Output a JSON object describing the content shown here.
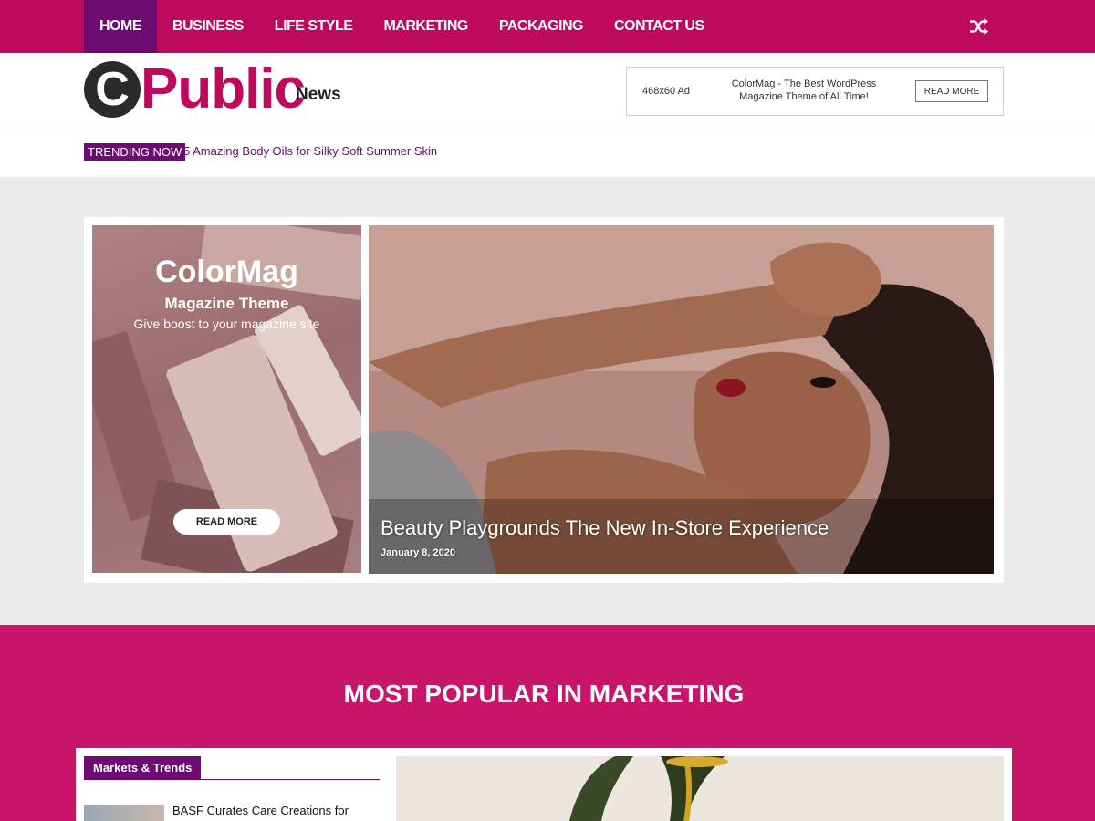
{
  "nav": {
    "items": [
      {
        "label": "HOME",
        "active": true
      },
      {
        "label": "BUSINESS"
      },
      {
        "label": "LIFE STYLE"
      },
      {
        "label": "MARKETING"
      },
      {
        "label": "PACKAGING"
      },
      {
        "label": "CONTACT US"
      }
    ],
    "random_icon": "shuffle-icon"
  },
  "logo": {
    "letter": "C",
    "main": "Public",
    "sub": "News"
  },
  "ad": {
    "size_label": "468x60 Ad",
    "text": "ColorMag - The Best WordPress Magazine Theme of All Time!",
    "button": "READ MORE"
  },
  "trending": {
    "label": "TRENDING NOW",
    "headline": "5 Amazing Body Oils for Silky Soft Summer Skin"
  },
  "promo": {
    "title": "ColorMag",
    "subtitle": "Magazine Theme",
    "tagline": "Give boost to your magazine site",
    "button": "READ MORE"
  },
  "hero": {
    "title": "Beauty Playgrounds The New In-Store Experience",
    "date": "January 8, 2020"
  },
  "popular": {
    "heading": "MOST POPULAR IN MARKETING",
    "category": "Markets & Trends",
    "first_article": "BASF Curates Care Creations for"
  },
  "colors": {
    "primary": "#bd0a5c",
    "active": "#6e0b72",
    "popular_bg": "#c91569"
  }
}
